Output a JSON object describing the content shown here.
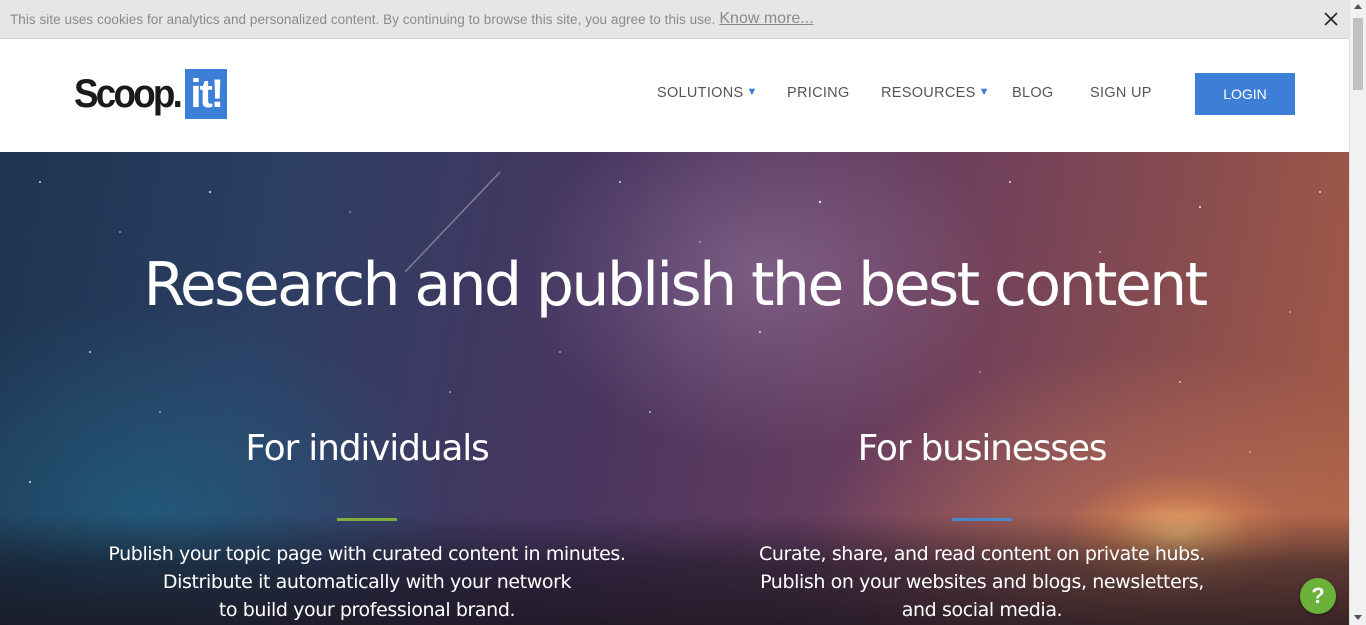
{
  "cookie_bar": {
    "text": "This site uses cookies for analytics and personalized content. By continuing to browse this site, you agree to this use.",
    "link": "Know more...",
    "close_icon": "close-icon"
  },
  "header": {
    "logo_scoop": "Scoop.",
    "logo_it": "it!",
    "nav": [
      {
        "label": "SOLUTIONS",
        "has_dropdown": true
      },
      {
        "label": "PRICING",
        "has_dropdown": false
      },
      {
        "label": "RESOURCES",
        "has_dropdown": true
      },
      {
        "label": "BLOG",
        "has_dropdown": false
      },
      {
        "label": "SIGN UP",
        "has_dropdown": false
      }
    ],
    "caret": "▼",
    "login_label": "LOGIN"
  },
  "hero": {
    "title": "Research and publish the best content",
    "columns": [
      {
        "title": "For individuals",
        "accent_color": "#7fad3c",
        "lines": [
          "Publish your topic page with curated content in minutes.",
          "Distribute it automatically with your network",
          "to build your professional brand."
        ]
      },
      {
        "title": "For businesses",
        "accent_color": "#4a86cc",
        "lines": [
          "Curate, share, and read content on private hubs.",
          "Publish on your websites and blogs, newsletters,",
          "and social media."
        ]
      }
    ]
  },
  "help": {
    "label": "?",
    "icon": "help-icon",
    "color": "#6bb23a"
  },
  "colors": {
    "brand": "#3d7fd6"
  }
}
